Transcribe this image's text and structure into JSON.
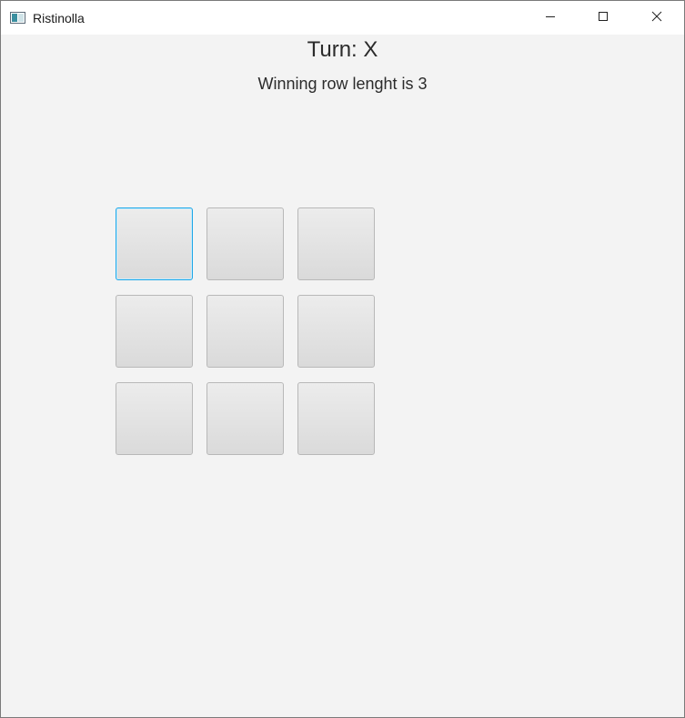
{
  "window": {
    "title": "Ristinolla",
    "icon": "app-window-icon",
    "controls": {
      "minimize": "minimize-icon",
      "maximize": "maximize-icon",
      "close": "close-icon"
    }
  },
  "status": {
    "turn": "Turn: X",
    "winning_row": "Winning row lenght is 3"
  },
  "board": {
    "rows": 3,
    "cols": 3,
    "cells": [
      "",
      "",
      "",
      "",
      "",
      "",
      "",
      "",
      ""
    ],
    "focused_index": 0
  },
  "colors": {
    "background": "#f3f3f3",
    "focus_border": "#1ea7e8",
    "cell_border": "#b8b8b8"
  }
}
